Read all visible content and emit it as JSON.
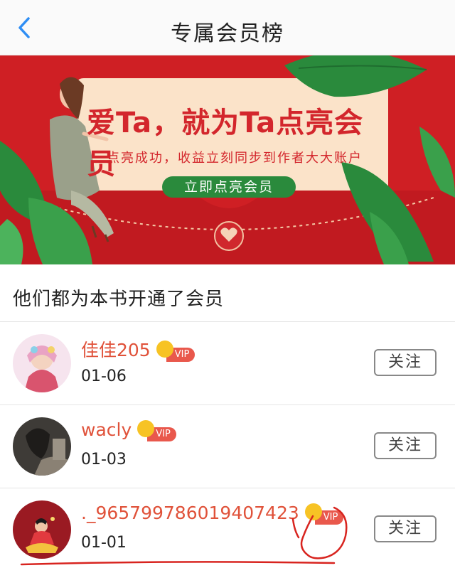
{
  "header": {
    "title": "专属会员榜"
  },
  "banner": {
    "headline": "爱Ta，就为Ta点亮会员",
    "subtitle": "点亮成功，收益立刻同步到作者大大账户",
    "button_label": "立即点亮会员"
  },
  "section": {
    "title": "他们都为本书开通了会员"
  },
  "members": [
    {
      "name": "佳佳205",
      "badge": "VIP",
      "date": "01-06",
      "follow_label": "关注"
    },
    {
      "name": "wacly",
      "badge": "VIP",
      "date": "01-03",
      "follow_label": "关注"
    },
    {
      "name": "._965799786019407423",
      "badge": "VIP",
      "date": "01-01",
      "follow_label": "关注"
    }
  ],
  "colors": {
    "accent_red": "#cf1f24",
    "name_color": "#e0523a",
    "vip_tag": "#e9584c",
    "crown": "#f7c324",
    "banner_button": "#2a8a3c",
    "back_arrow": "#2f8ef4"
  },
  "icons": [
    "back-arrow-icon",
    "vip-crown-icon",
    "heart-seal-icon"
  ]
}
